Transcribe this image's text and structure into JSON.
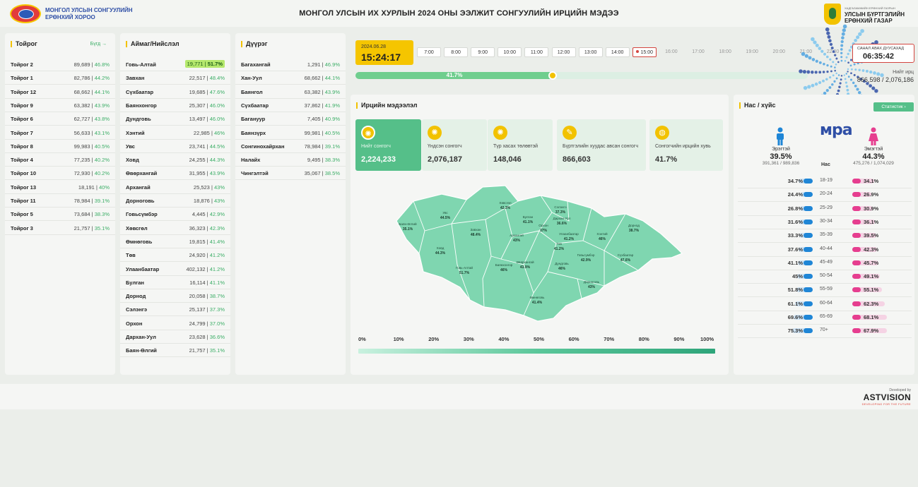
{
  "header": {
    "org_line1": "МОНГОЛ УЛСЫН СОНГУУЛИЙН",
    "org_line2": "ЕРӨНХИЙ ХОРОО",
    "title": "МОНГОЛ УЛСЫН ИХ ХУРЛЫН 2024 ОНЫ ЭЭЛЖИТ СОНГУУЛИЙН ИРЦИЙН МЭДЭЭ",
    "right_small": "ХАДГАЛАМЖИЙН ЕРӨНХИЙ ГАЗРЫН",
    "right_line1": "УЛСЫН БҮРТГЭЛИЙН",
    "right_line2": "ЕРӨНХИЙ ГАЗАР"
  },
  "toirog": {
    "title": "Тойрог",
    "all_label": "Бүгд",
    "rows": [
      {
        "name": "Тойрог 2",
        "count": "89,689",
        "pct": "46.8%"
      },
      {
        "name": "Тойрог 1",
        "count": "82,786",
        "pct": "44.2%"
      },
      {
        "name": "Тойрог 12",
        "count": "68,662",
        "pct": "44.1%"
      },
      {
        "name": "Тойрог 9",
        "count": "63,382",
        "pct": "43.9%"
      },
      {
        "name": "Тойрог 6",
        "count": "62,727",
        "pct": "43.8%"
      },
      {
        "name": "Тойрог 7",
        "count": "56,633",
        "pct": "43.1%"
      },
      {
        "name": "Тойрог 8",
        "count": "99,983",
        "pct": "40.5%"
      },
      {
        "name": "Тойрог 4",
        "count": "77,235",
        "pct": "40.2%"
      },
      {
        "name": "Тойрог 10",
        "count": "72,930",
        "pct": "40.2%"
      },
      {
        "name": "Тойрог 13",
        "count": "18,191",
        "pct": "40%"
      },
      {
        "name": "Тойрог 11",
        "count": "78,984",
        "pct": "39.1%"
      },
      {
        "name": "Тойрог 5",
        "count": "73,684",
        "pct": "38.3%"
      },
      {
        "name": "Тойрог 3",
        "count": "21,757",
        "pct": "35.1%"
      }
    ]
  },
  "aimag": {
    "title": "Аймаг/Нийслэл",
    "rows": [
      {
        "name": "Говь-Алтай",
        "count": "19,771",
        "pct": "51.7%"
      },
      {
        "name": "Завхан",
        "count": "22,517",
        "pct": "48.4%"
      },
      {
        "name": "Сүхбаатар",
        "count": "19,685",
        "pct": "47.6%"
      },
      {
        "name": "Баянхонгор",
        "count": "25,307",
        "pct": "46.0%"
      },
      {
        "name": "Дундговь",
        "count": "13,497",
        "pct": "46.0%"
      },
      {
        "name": "Хэнтий",
        "count": "22,985",
        "pct": "46%"
      },
      {
        "name": "Увс",
        "count": "23,741",
        "pct": "44.5%"
      },
      {
        "name": "Ховд",
        "count": "24,255",
        "pct": "44.3%"
      },
      {
        "name": "Өвөрхангай",
        "count": "31,955",
        "pct": "43.9%"
      },
      {
        "name": "Архангай",
        "count": "25,523",
        "pct": "43%"
      },
      {
        "name": "Дорноговь",
        "count": "18,876",
        "pct": "43%"
      },
      {
        "name": "Говьсүмбэр",
        "count": "4,445",
        "pct": "42.9%"
      },
      {
        "name": "Хөвсгөл",
        "count": "36,323",
        "pct": "42.3%"
      },
      {
        "name": "Өмнөговь",
        "count": "19,815",
        "pct": "41.4%"
      },
      {
        "name": "Төв",
        "count": "24,920",
        "pct": "41.2%"
      },
      {
        "name": "Улаанбаатар",
        "count": "402,132",
        "pct": "41.2%"
      },
      {
        "name": "Булган",
        "count": "16,114",
        "pct": "41.1%"
      },
      {
        "name": "Дорнод",
        "count": "20,058",
        "pct": "38.7%"
      },
      {
        "name": "Сэлэнгэ",
        "count": "25,137",
        "pct": "37.3%"
      },
      {
        "name": "Орхон",
        "count": "24,799",
        "pct": "37.0%"
      },
      {
        "name": "Дархан-Уул",
        "count": "23,628",
        "pct": "36.6%"
      },
      {
        "name": "Баян-Өлгий",
        "count": "21,757",
        "pct": "35.1%"
      }
    ]
  },
  "duureg": {
    "title": "Дүүрэг",
    "rows": [
      {
        "name": "Багахангай",
        "count": "1,291",
        "pct": "46.9%"
      },
      {
        "name": "Хан-Уул",
        "count": "68,662",
        "pct": "44.1%"
      },
      {
        "name": "Баянгол",
        "count": "63,382",
        "pct": "43.9%"
      },
      {
        "name": "Сүхбаатар",
        "count": "37,862",
        "pct": "41.9%"
      },
      {
        "name": "Багануур",
        "count": "7,405",
        "pct": "40.9%"
      },
      {
        "name": "Баянзүрх",
        "count": "99,981",
        "pct": "40.5%"
      },
      {
        "name": "Сонгинохайрхан",
        "count": "78,984",
        "pct": "39.1%"
      },
      {
        "name": "Налайх",
        "count": "9,495",
        "pct": "38.3%"
      },
      {
        "name": "Чингэлтэй",
        "count": "35,067",
        "pct": "38.5%"
      }
    ]
  },
  "timeline": {
    "date": "2024.06.28",
    "time": "15:24:17",
    "hours": [
      "7:00",
      "8:00",
      "9:00",
      "10:00",
      "11:00",
      "12:00",
      "13:00",
      "14:00",
      "15:00",
      "16:00",
      "17:00",
      "18:00",
      "19:00",
      "20:00",
      "21:00",
      "22:00"
    ],
    "current_hour_index": 8,
    "progress_pct": 41.7,
    "progress_label": "41.7%",
    "countdown_label": "САНАЛ АВАХ ДУУСАХАД",
    "countdown": "06:35:42",
    "turnout_label": "Нийт ирц",
    "turnout_value": "866,598 / 2,076,186"
  },
  "irts": {
    "title": "Ирцийн мэдээлэл",
    "cards": [
      {
        "label": "Нийт сонгогч",
        "value": "2,224,233",
        "icon": "voters-icon"
      },
      {
        "label": "Үндсэн сонгогч",
        "value": "2,076,187",
        "icon": "main-voters-icon"
      },
      {
        "label": "Түр хасах төлөвтэй",
        "value": "148,046",
        "icon": "temp-removed-icon"
      },
      {
        "label": "Бүртгэлийн хуудас авсан сонгогч",
        "value": "866,603",
        "icon": "registered-icon"
      },
      {
        "label": "Сонгогчийн ирцийн хувь",
        "value": "41.7%",
        "icon": "turnout-icon"
      }
    ]
  },
  "map": {
    "regions": [
      {
        "name": "Баян-Өлгий",
        "pct": "35.1%"
      },
      {
        "name": "Увс",
        "pct": "44.5%"
      },
      {
        "name": "Ховд",
        "pct": "44.3%"
      },
      {
        "name": "Завхан",
        "pct": "48.4%"
      },
      {
        "name": "Говь-Алтай",
        "pct": "51.7%"
      },
      {
        "name": "Хөвсгөл",
        "pct": "42.3%"
      },
      {
        "name": "Булган",
        "pct": "41.1%"
      },
      {
        "name": "Архангай",
        "pct": "43%"
      },
      {
        "name": "Баянхонгор",
        "pct": "46%"
      },
      {
        "name": "Өвөрхангай",
        "pct": "43.9%"
      },
      {
        "name": "Орхон",
        "pct": "37%"
      },
      {
        "name": "Сэлэнгэ",
        "pct": "37.3%"
      },
      {
        "name": "Дархан-Уул",
        "pct": "36.6%"
      },
      {
        "name": "Улаанбаатар",
        "pct": "41.2%"
      },
      {
        "name": "Төв",
        "pct": "41.2%"
      },
      {
        "name": "Хэнтий",
        "pct": "46%"
      },
      {
        "name": "Дорнод",
        "pct": "38.7%"
      },
      {
        "name": "Сүхбаатар",
        "pct": "47.6%"
      },
      {
        "name": "Говьсүмбэр",
        "pct": "42.9%"
      },
      {
        "name": "Дундговь",
        "pct": "46%"
      },
      {
        "name": "Дорноговь",
        "pct": "43%"
      },
      {
        "name": "Өмнөговь",
        "pct": "41.4%"
      }
    ],
    "scale": [
      "0%",
      "10%",
      "20%",
      "30%",
      "40%",
      "50%",
      "60%",
      "70%",
      "80%",
      "90%",
      "100%"
    ]
  },
  "age": {
    "title": "Нас / хүйс",
    "stat_button": "Статистик",
    "brand": "мра",
    "male_label": "Эрэгтэй",
    "male_pct": "39.5%",
    "male_count": "391,361 / 989,836",
    "female_label": "Эмэгтэй",
    "female_pct": "44.3%",
    "female_count": "475,276 / 1,074,029",
    "age_header": "Нас",
    "rows": [
      {
        "range": "18-19",
        "male": "34.7%",
        "female": "34.1%",
        "mv": 34.7,
        "fv": 34.1
      },
      {
        "range": "20-24",
        "male": "24.4%",
        "female": "26.9%",
        "mv": 24.4,
        "fv": 26.9
      },
      {
        "range": "25-29",
        "male": "26.8%",
        "female": "30.9%",
        "mv": 26.8,
        "fv": 30.9
      },
      {
        "range": "30-34",
        "male": "31.6%",
        "female": "36.1%",
        "mv": 31.6,
        "fv": 36.1
      },
      {
        "range": "35-39",
        "male": "33.3%",
        "female": "39.5%",
        "mv": 33.3,
        "fv": 39.5
      },
      {
        "range": "40-44",
        "male": "37.6%",
        "female": "42.3%",
        "mv": 37.6,
        "fv": 42.3
      },
      {
        "range": "45-49",
        "male": "41.1%",
        "female": "45.7%",
        "mv": 41.1,
        "fv": 45.7
      },
      {
        "range": "50-54",
        "male": "45%",
        "female": "49.1%",
        "mv": 45,
        "fv": 49.1
      },
      {
        "range": "55-59",
        "male": "51.8%",
        "female": "55.1%",
        "mv": 51.8,
        "fv": 55.1
      },
      {
        "range": "60-64",
        "male": "61.1%",
        "female": "62.3%",
        "mv": 61.1,
        "fv": 62.3
      },
      {
        "range": "65-69",
        "male": "69.6%",
        "female": "68.1%",
        "mv": 69.6,
        "fv": 68.1
      },
      {
        "range": "70+",
        "male": "75.3%",
        "female": "67.9%",
        "mv": 75.3,
        "fv": 67.9
      }
    ]
  },
  "footer": {
    "dev_small": "Developed by",
    "dev_brand": "ASTVISION",
    "dev_tag": "DEVELOPING FOR THE FUTURE"
  },
  "colors": {
    "accent": "#55bf89",
    "yellow": "#f2c200",
    "male": "#1f86d6",
    "female": "#e63e8f"
  }
}
